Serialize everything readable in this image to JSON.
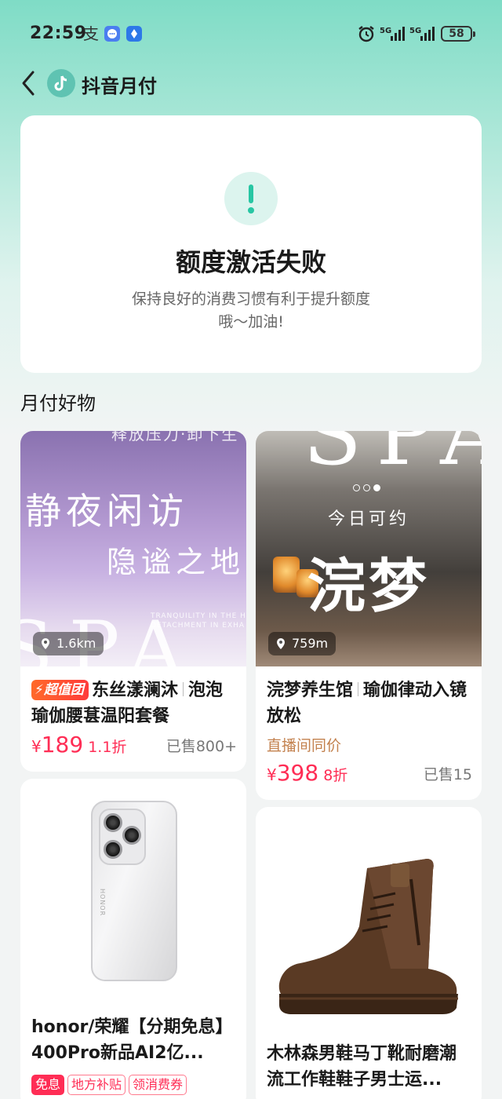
{
  "status_bar": {
    "time": "22:59",
    "alipay_glyph": "支",
    "net1": "5G",
    "net2": "5G",
    "battery": "58"
  },
  "header": {
    "title": "抖音月付"
  },
  "status_card": {
    "title": "额度激活失败",
    "description_line1": "保持良好的消费习惯有利于提升额度",
    "description_line2": "哦～加油!"
  },
  "section": {
    "title": "月付好物"
  },
  "products": [
    {
      "image_text_top": "释放压力·卸下生",
      "image_text_big1": "静夜闲访",
      "image_text_big2": "隐谧之地",
      "image_text_small1": "TRANQUILITY IN THE H",
      "image_text_small2": "DETACHMENT IN EXHA",
      "image_text_spa": "SPA",
      "distance": "1.6km",
      "tag": "超值团",
      "title_a": "东丝漾澜沐",
      "title_b": "泡泡瑜伽腰葚温阳套餐",
      "price_currency": "¥",
      "price": "189",
      "discount": "1.1折",
      "sold": "已售800+"
    },
    {
      "image_text_spa": "SPA",
      "image_text_sub": "今日可约",
      "image_text_big": "浣梦",
      "distance": "759m",
      "title_a": "浣梦养生馆",
      "title_b": "瑜伽律动入镜放松",
      "live_price": "直播间同价",
      "price_currency": "¥",
      "price": "398",
      "discount": "8折",
      "sold": "已售15"
    },
    {
      "phone_brand": "HONOR",
      "title": "honor/荣耀【分期免息】400Pro新品AI2亿...",
      "tags": [
        "免息",
        "地方补贴",
        "领消费券"
      ]
    },
    {
      "title": "木林森男鞋马丁靴耐磨潮流工作鞋鞋子男士运..."
    }
  ],
  "colors": {
    "accent_green": "#27c6a3",
    "price_red": "#ff2d55",
    "live_price_brown": "#c3814e"
  }
}
